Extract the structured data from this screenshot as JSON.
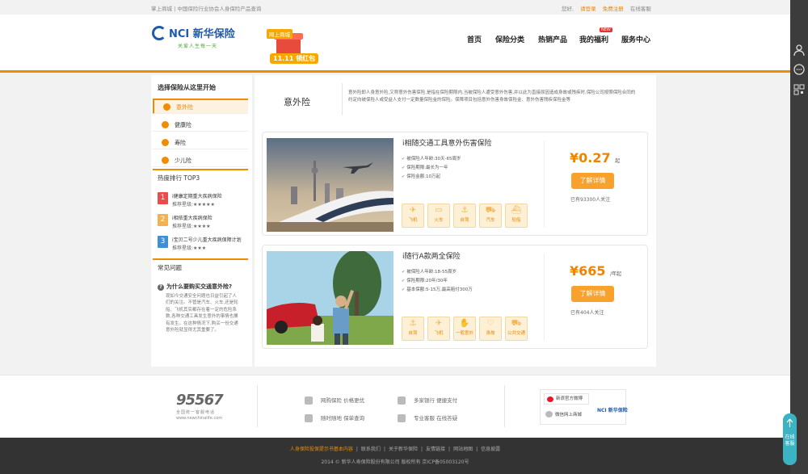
{
  "topbar": {
    "left": "掌上商城 | 中国保险行业协会人身保险产品查询",
    "greeting": "您好,",
    "login": "请登录",
    "register": "免费注册",
    "service": "在线客服"
  },
  "logo": {
    "name": "NCI 新华保险",
    "slogan": "关爱人生每一天"
  },
  "badge": {
    "tag": "网上商城",
    "label": "11.11 领红包"
  },
  "nav": {
    "items": [
      "首页",
      "保险分类",
      "热销产品",
      "我的福利",
      "服务中心"
    ],
    "new_badge": "NEW"
  },
  "sidebar": {
    "heading": "选择保险从这里开始",
    "categories": [
      "意外险",
      "健康险",
      "寿险",
      "少儿险"
    ],
    "ranking_title": "热度排行 TOP3",
    "ranking": [
      {
        "num": "1",
        "name": "i健康定期重大疾病保险",
        "stars": "推荐星级:★★★★★"
      },
      {
        "num": "2",
        "name": "i相依重大疾病保险",
        "stars": "推荐星级:★★★★"
      },
      {
        "num": "3",
        "name": "i宝贝二号少儿重大疾病保障计划",
        "stars": "推荐星级:★★★"
      }
    ],
    "faq_title": "常见问题",
    "faq_q": "为什么要购买交通意外险?",
    "faq_a": "现如今交通安全问题也日益引起了人们的关注。不管是汽车、火车,还是轮船、飞机其实都存在着一定的危险系数,各种交通工具发生意外的事情也屡有发生。在这种情况下,购买一份交通意外险就显得尤其重要了。"
  },
  "main": {
    "category": "意外险",
    "description": "意外险即人身意外险,又称意外伤害保险,是指在保险期限内,当被保险人遭受意外伤害,并以此为直接原因造成身故或残疾时,保险公司按照保险合同的约定向被保险人或受益人支付一定数量保险金的保险。保障项目包括意外伤害身故保险金、意外伤害残疾保险金等",
    "products": [
      {
        "name": "i相随交通工具意外伤害保险",
        "features": [
          "被保险人年龄:30天-65周岁",
          "保险期限:最长为一年",
          "保险金额:10万起"
        ],
        "tags": [
          {
            "glyph": "✈",
            "label": "飞机"
          },
          {
            "glyph": "▭",
            "label": "火车"
          },
          {
            "glyph": "⚓",
            "label": "自驾"
          },
          {
            "glyph": "⛟",
            "label": "汽车"
          },
          {
            "glyph": "⛴",
            "label": "轮船"
          }
        ],
        "price": "¥0.27",
        "price_unit": "起",
        "button": "了解详情",
        "followers": "已有93300人关注"
      },
      {
        "name": "i随行A款两全保险",
        "features": [
          "被保险人年龄:18-55周岁",
          "保险期限:20年/30年",
          "基本保额:5-15万,最高赔付300万"
        ],
        "tags": [
          {
            "glyph": "⚓",
            "label": "自驾"
          },
          {
            "glyph": "✈",
            "label": "飞机"
          },
          {
            "glyph": "✋",
            "label": "一般意外"
          },
          {
            "glyph": "♡",
            "label": "身故"
          },
          {
            "glyph": "⛟",
            "label": "公共交通"
          }
        ],
        "price": "¥665",
        "price_unit": "/年起",
        "button": "了解详情",
        "followers": "已有404人关注"
      }
    ]
  },
  "footer": {
    "hotline": "95567",
    "hotline_sub": "全国统一客服电话",
    "site": "www.newchinalife.com",
    "features": [
      "网购保险 价格更优",
      "多家银行 便捷支付",
      "随时随地 保单查询",
      "专业客服 在线答疑"
    ],
    "weibo": "新浪官方微博",
    "wechat": "微信网上商城",
    "brand": "NCI 新华保险"
  },
  "bottom": {
    "links": [
      "人身保险投保提示书基本内容",
      "联系我们",
      "关于新华保险",
      "友情链接",
      "网站地图",
      "信息披露"
    ],
    "copyright": "2014 © 新华人寿保险股份有限公司 版权所有 京ICP备05003120号"
  },
  "float": {
    "label": "在线客服"
  },
  "colors": {
    "accent": "#f08c00",
    "brand_blue": "#1e5aa8",
    "button": "#f8a12c"
  }
}
